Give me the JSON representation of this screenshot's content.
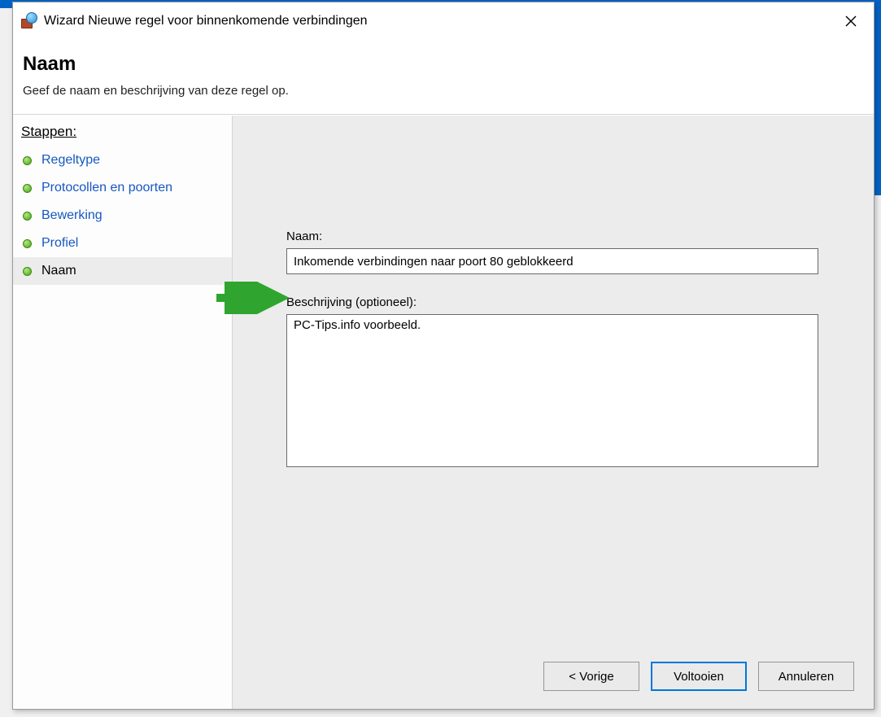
{
  "window": {
    "title": "Wizard Nieuwe regel voor binnenkomende verbindingen"
  },
  "header": {
    "name": "Naam",
    "description": "Geef de naam en beschrijving van deze regel op."
  },
  "sidebar": {
    "title": "Stappen:",
    "steps": [
      {
        "label": "Regeltype"
      },
      {
        "label": "Protocollen en poorten"
      },
      {
        "label": "Bewerking"
      },
      {
        "label": "Profiel"
      },
      {
        "label": "Naam"
      }
    ]
  },
  "form": {
    "name_label": "Naam:",
    "name_value": "Inkomende verbindingen naar poort 80 geblokkeerd",
    "desc_label": "Beschrijving (optioneel):",
    "desc_value": "PC-Tips.info voorbeeld."
  },
  "buttons": {
    "back": "< Vorige",
    "finish": "Voltooien",
    "cancel": "Annuleren"
  }
}
